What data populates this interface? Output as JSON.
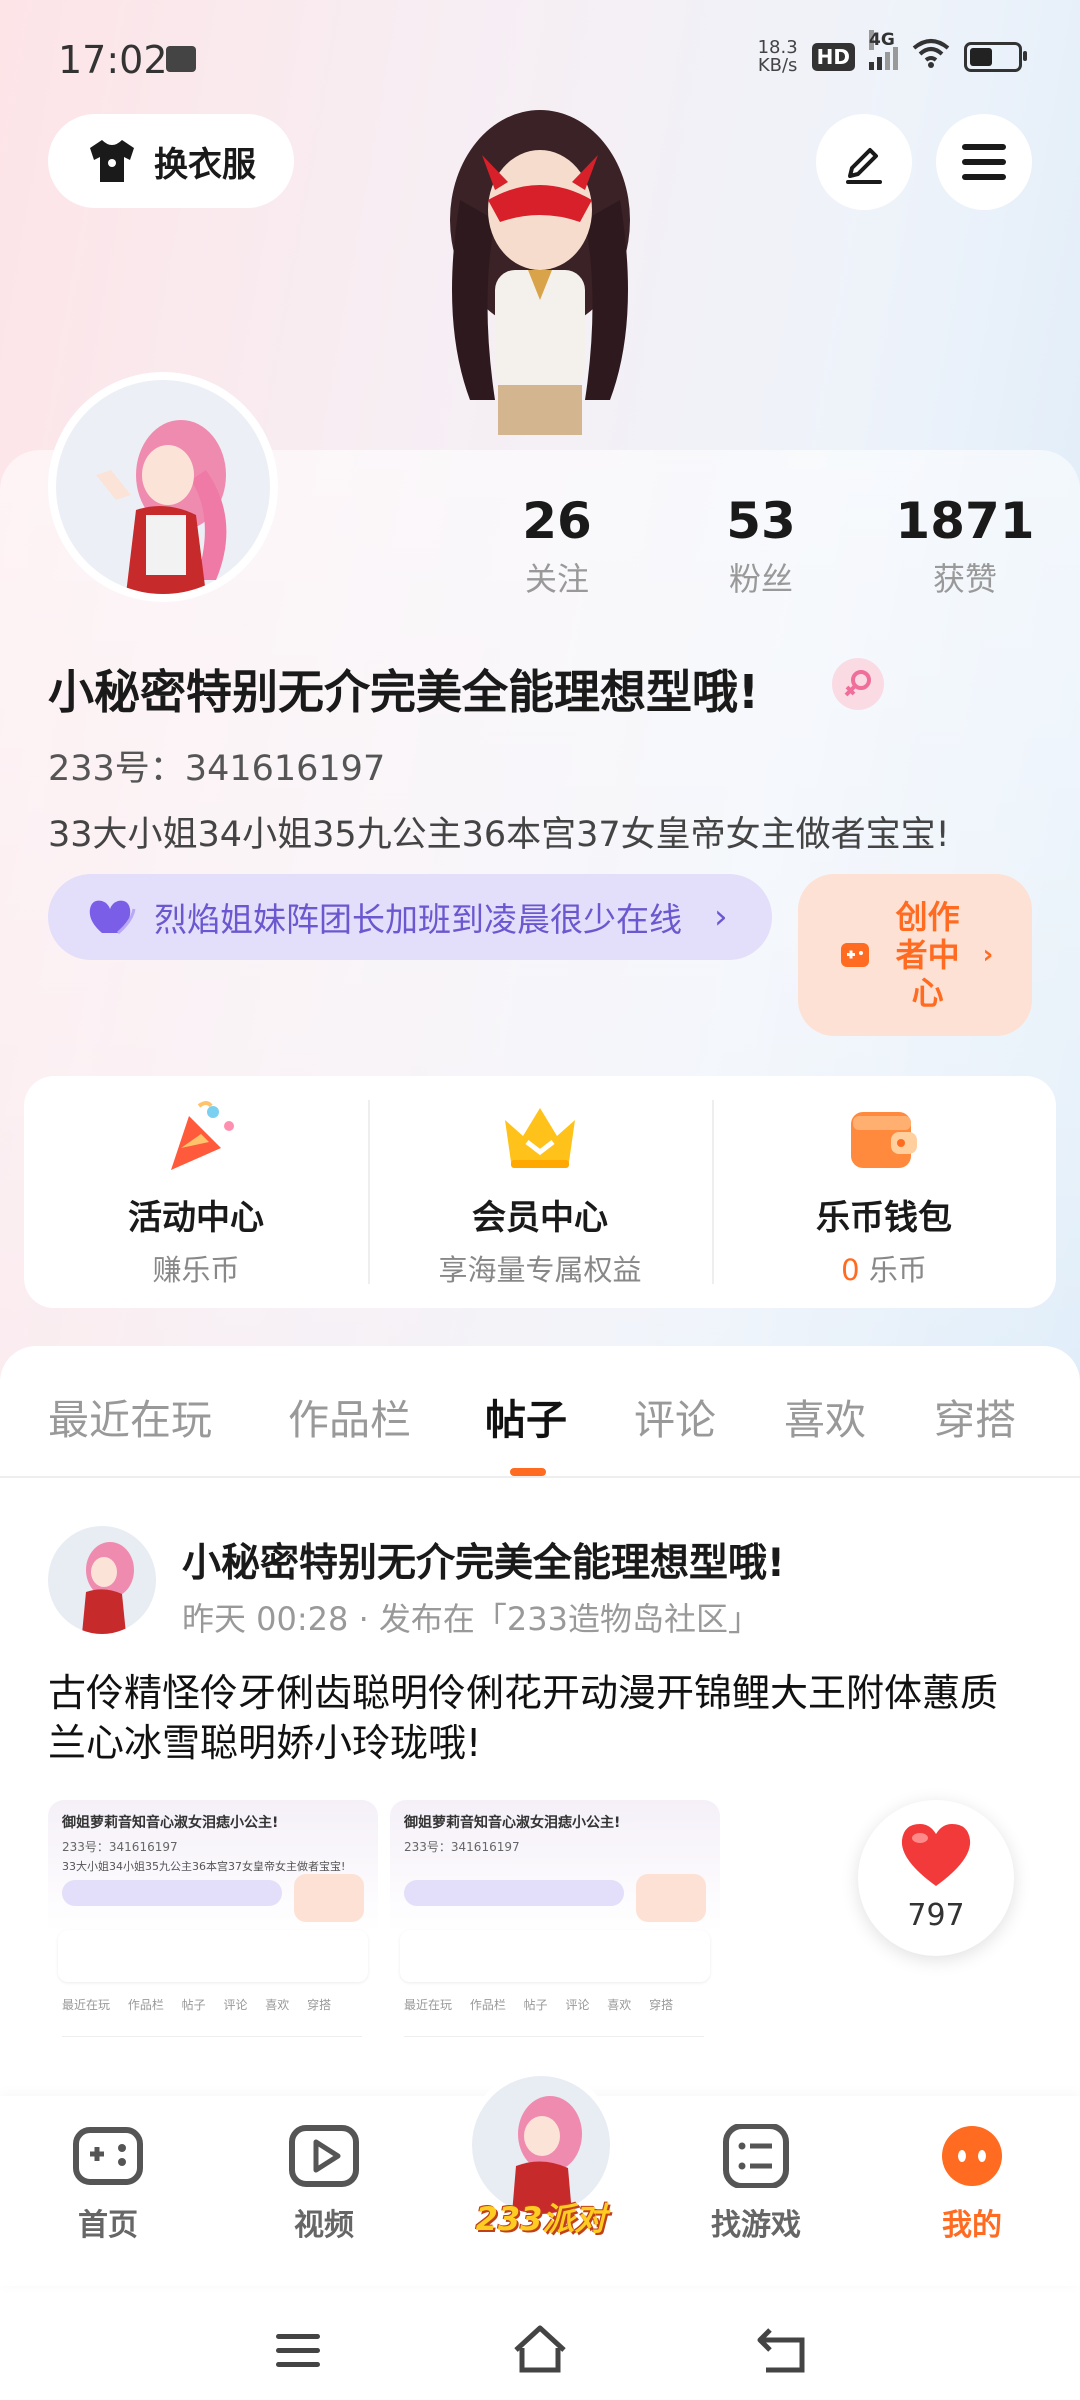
{
  "status_bar": {
    "time": "17:02",
    "net_speed_top": "18.3",
    "net_speed_unit": "KB/s",
    "hd": "HD",
    "network": "4G"
  },
  "header": {
    "wardrobe_label": "换衣服",
    "edit_icon": "pen-icon",
    "menu_icon": "hamburger-icon"
  },
  "profile": {
    "stats": [
      {
        "value": "26",
        "label": "关注"
      },
      {
        "value": "53",
        "label": "粉丝"
      },
      {
        "value": "1871",
        "label": "获赞"
      }
    ],
    "name": "小秘密特别无介完美全能理想型哦!",
    "uid": "233号：341616197",
    "bio": "33大小姐34小姐35九公主36本宫37女皇帝女主做者宝宝!",
    "group": "烈焰姐妹阵团长加班到凌晨很少在线",
    "creator_center": "创作者中心"
  },
  "features": [
    {
      "title": "活动中心",
      "subtitle": "赚乐币"
    },
    {
      "title": "会员中心",
      "subtitle": "享海量专属权益"
    },
    {
      "title": "乐币钱包",
      "amount": "0",
      "unit": "乐币"
    }
  ],
  "tabs": [
    "最近在玩",
    "作品栏",
    "帖子",
    "评论",
    "喜欢",
    "穿搭"
  ],
  "active_tab": "帖子",
  "post": {
    "author": "小秘密特别无介完美全能理想型哦!",
    "meta": "昨天 00:28 · 发布在「233造物岛社区」",
    "text": "古伶精怪伶牙俐齿聪明伶俐花开动漫开锦鲤大王附体蕙质兰心冰雪聪明娇小玲珑哦!",
    "likes": "797",
    "thumb1": {
      "title": "御姐萝莉音知音心淑女泪痣小公主!",
      "uid": "233号：341616197",
      "bio": "33大小姐34小姐35九公主36本宫37女皇帝女主做者宝宝!",
      "tabs": "最近在玩 作品栏 帖子 评论 喜欢 穿搭"
    },
    "thumb2": {
      "title": "御姐萝莉音知音心淑女泪痣小公主!",
      "uid": "233号：341616197",
      "tabs": "最近在玩 作品栏 帖子 评论 喜欢 穿搭"
    }
  },
  "bottom_nav": [
    {
      "label": "首页"
    },
    {
      "label": "视频"
    },
    {
      "label": "233派对"
    },
    {
      "label": "找游戏"
    },
    {
      "label": "我的"
    }
  ],
  "colors": {
    "accent": "#ff6b21",
    "purple": "#6b57cf",
    "like_red": "#f23a3a"
  }
}
